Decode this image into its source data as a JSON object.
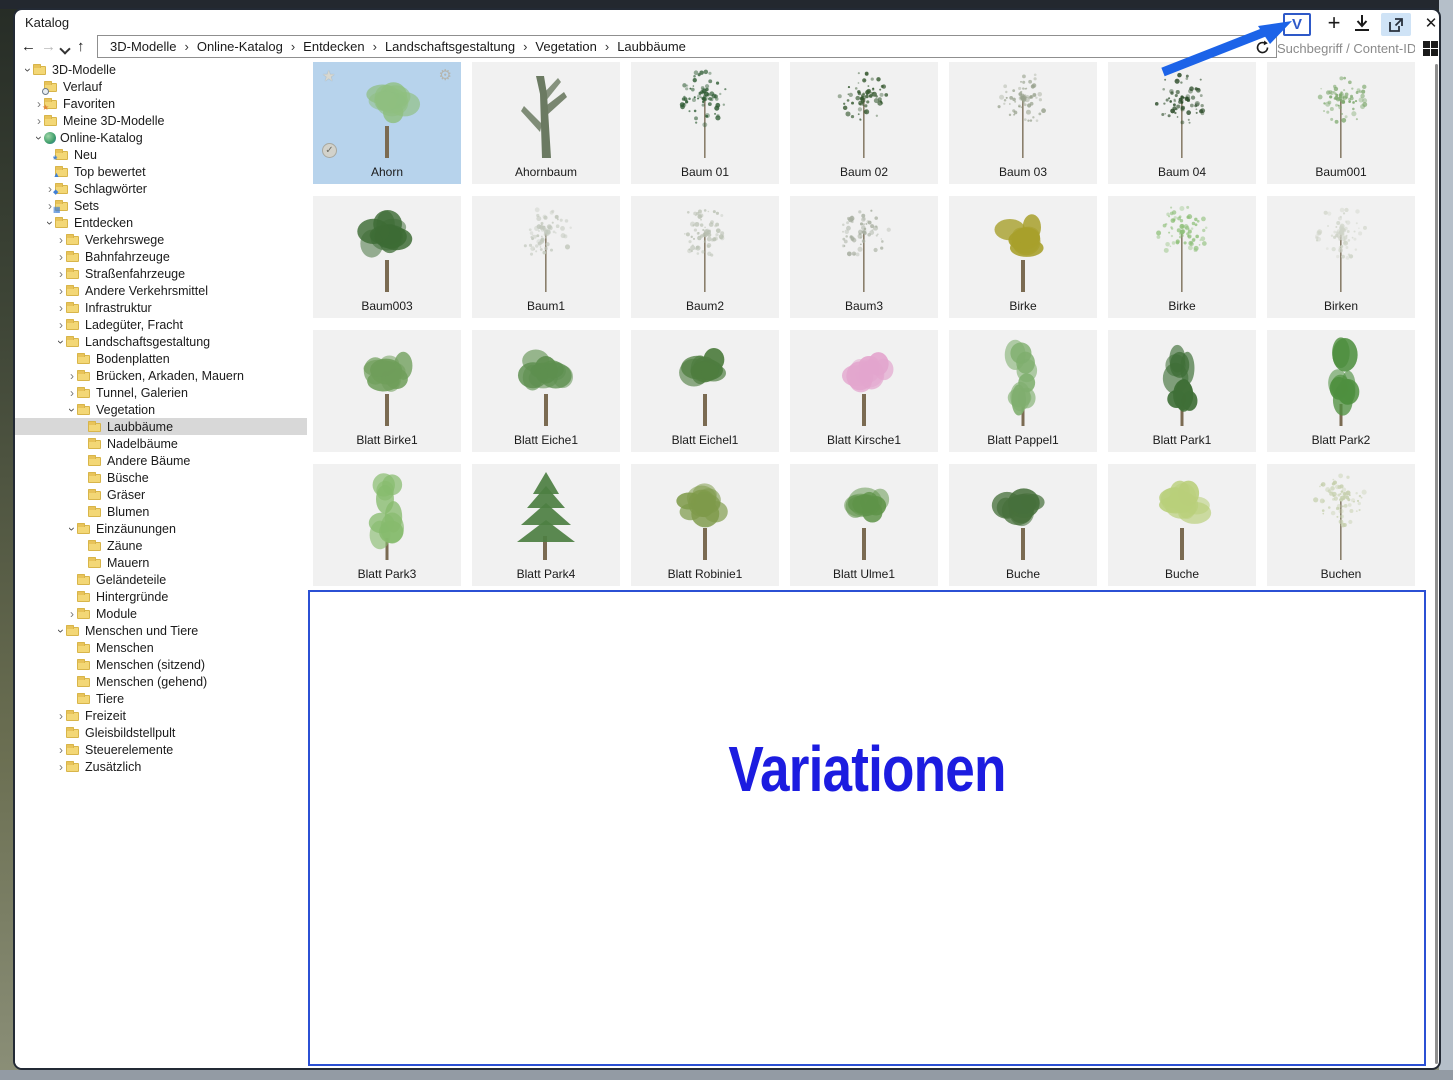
{
  "window": {
    "title": "Katalog"
  },
  "toolbar": {
    "variations_label": "V",
    "plus_label": "+",
    "close_label": "✕",
    "nav": {
      "back": "←",
      "forward": "→",
      "up": "↑"
    }
  },
  "breadcrumb": {
    "separator": "›",
    "items": [
      "3D-Modelle",
      "Online-Katalog",
      "Entdecken",
      "Landschaftsgestaltung",
      "Vegetation",
      "Laubbäume"
    ]
  },
  "search": {
    "placeholder": "Suchbegriff / Content-ID"
  },
  "tree": {
    "items": [
      {
        "label": "3D-Modelle",
        "level": 0,
        "chevron": "expanded",
        "icon": "folder"
      },
      {
        "label": "Verlauf",
        "level": 1,
        "chevron": "none",
        "icon": "history"
      },
      {
        "label": "Favoriten",
        "level": 1,
        "chevron": "collapsed",
        "icon": "favorites"
      },
      {
        "label": "Meine 3D-Modelle",
        "level": 1,
        "chevron": "collapsed",
        "icon": "folder"
      },
      {
        "label": "Online-Katalog",
        "level": 1,
        "chevron": "expanded",
        "icon": "globe"
      },
      {
        "label": "Neu",
        "level": 2,
        "chevron": "none",
        "icon": "new"
      },
      {
        "label": "Top bewertet",
        "level": 2,
        "chevron": "none",
        "icon": "top"
      },
      {
        "label": "Schlagwörter",
        "level": 2,
        "chevron": "collapsed",
        "icon": "tags"
      },
      {
        "label": "Sets",
        "level": 2,
        "chevron": "collapsed",
        "icon": "sets"
      },
      {
        "label": "Entdecken",
        "level": 2,
        "chevron": "expanded",
        "icon": "folder"
      },
      {
        "label": "Verkehrswege",
        "level": 3,
        "chevron": "collapsed",
        "icon": "folder"
      },
      {
        "label": "Bahnfahrzeuge",
        "level": 3,
        "chevron": "collapsed",
        "icon": "folder"
      },
      {
        "label": "Straßenfahrzeuge",
        "level": 3,
        "chevron": "collapsed",
        "icon": "folder"
      },
      {
        "label": "Andere Verkehrsmittel",
        "level": 3,
        "chevron": "collapsed",
        "icon": "folder"
      },
      {
        "label": "Infrastruktur",
        "level": 3,
        "chevron": "collapsed",
        "icon": "folder"
      },
      {
        "label": "Ladegüter, Fracht",
        "level": 3,
        "chevron": "collapsed",
        "icon": "folder"
      },
      {
        "label": "Landschaftsgestaltung",
        "level": 3,
        "chevron": "expanded",
        "icon": "folder"
      },
      {
        "label": "Bodenplatten",
        "level": 4,
        "chevron": "none",
        "icon": "folder"
      },
      {
        "label": "Brücken, Arkaden, Mauern",
        "level": 4,
        "chevron": "collapsed",
        "icon": "folder"
      },
      {
        "label": "Tunnel, Galerien",
        "level": 4,
        "chevron": "collapsed",
        "icon": "folder"
      },
      {
        "label": "Vegetation",
        "level": 4,
        "chevron": "expanded",
        "icon": "folder"
      },
      {
        "label": "Laubbäume",
        "level": 5,
        "chevron": "none",
        "icon": "folder",
        "selected": true
      },
      {
        "label": "Nadelbäume",
        "level": 5,
        "chevron": "none",
        "icon": "folder"
      },
      {
        "label": "Andere Bäume",
        "level": 5,
        "chevron": "none",
        "icon": "folder"
      },
      {
        "label": "Büsche",
        "level": 5,
        "chevron": "none",
        "icon": "folder"
      },
      {
        "label": "Gräser",
        "level": 5,
        "chevron": "none",
        "icon": "folder"
      },
      {
        "label": "Blumen",
        "level": 5,
        "chevron": "none",
        "icon": "folder"
      },
      {
        "label": "Einzäunungen",
        "level": 4,
        "chevron": "expanded",
        "icon": "folder"
      },
      {
        "label": "Zäune",
        "level": 5,
        "chevron": "none",
        "icon": "folder"
      },
      {
        "label": "Mauern",
        "level": 5,
        "chevron": "none",
        "icon": "folder"
      },
      {
        "label": "Geländeteile",
        "level": 4,
        "chevron": "none",
        "icon": "folder"
      },
      {
        "label": "Hintergründe",
        "level": 4,
        "chevron": "none",
        "icon": "folder"
      },
      {
        "label": "Module",
        "level": 4,
        "chevron": "collapsed",
        "icon": "folder"
      },
      {
        "label": "Menschen und Tiere",
        "level": 3,
        "chevron": "expanded",
        "icon": "folder"
      },
      {
        "label": "Menschen",
        "level": 4,
        "chevron": "none",
        "icon": "folder"
      },
      {
        "label": "Menschen (sitzend)",
        "level": 4,
        "chevron": "none",
        "icon": "folder"
      },
      {
        "label": "Menschen (gehend)",
        "level": 4,
        "chevron": "none",
        "icon": "folder"
      },
      {
        "label": "Tiere",
        "level": 4,
        "chevron": "none",
        "icon": "folder"
      },
      {
        "label": "Freizeit",
        "level": 3,
        "chevron": "collapsed",
        "icon": "folder"
      },
      {
        "label": "Gleisbildstellpult",
        "level": 3,
        "chevron": "none",
        "icon": "folder"
      },
      {
        "label": "Steuerelemente",
        "level": 3,
        "chevron": "collapsed",
        "icon": "folder"
      },
      {
        "label": "Zusätzlich",
        "level": 3,
        "chevron": "collapsed",
        "icon": "folder"
      }
    ]
  },
  "grid": {
    "items": [
      {
        "label": "Ahorn",
        "type": "round",
        "color": "#8fbf7f",
        "selected": true
      },
      {
        "label": "Ahornbaum",
        "type": "trunk",
        "color": "#6b7a62"
      },
      {
        "label": "Baum 01",
        "type": "sparse",
        "color": "#2e5b33"
      },
      {
        "label": "Baum 02",
        "type": "sparse",
        "color": "#35582f"
      },
      {
        "label": "Baum 03",
        "type": "sparse",
        "color": "#9aa38f"
      },
      {
        "label": "Baum 04",
        "type": "sparse",
        "color": "#2f4e2c"
      },
      {
        "label": "Baum001",
        "type": "sparse",
        "color": "#7fa96f"
      },
      {
        "label": "Baum003",
        "type": "round",
        "color": "#3d6b35"
      },
      {
        "label": "Baum1",
        "type": "sparse",
        "color": "#c2c8bd"
      },
      {
        "label": "Baum2",
        "type": "sparse",
        "color": "#b9c0b2"
      },
      {
        "label": "Baum3",
        "type": "sparse",
        "color": "#a9b0a2"
      },
      {
        "label": "Birke",
        "type": "round",
        "color": "#a8a02c"
      },
      {
        "label": "Birke",
        "type": "sparse",
        "color": "#8fc07a"
      },
      {
        "label": "Birken",
        "type": "sparse",
        "color": "#cfd4c8"
      },
      {
        "label": "Blatt Birke1",
        "type": "round",
        "color": "#6f9e5a"
      },
      {
        "label": "Blatt Eiche1",
        "type": "round",
        "color": "#5d8f4e"
      },
      {
        "label": "Blatt Eichel1",
        "type": "round",
        "color": "#4e7d3f"
      },
      {
        "label": "Blatt Kirsche1",
        "type": "round",
        "color": "#e3a6ce"
      },
      {
        "label": "Blatt Pappel1",
        "type": "tall",
        "color": "#7fae6e"
      },
      {
        "label": "Blatt Park1",
        "type": "tall",
        "color": "#3f6f37"
      },
      {
        "label": "Blatt Park2",
        "type": "tall",
        "color": "#4e8f3f"
      },
      {
        "label": "Blatt Park3",
        "type": "tall",
        "color": "#86bb6d"
      },
      {
        "label": "Blatt Park4",
        "type": "conifer",
        "color": "#4d7f42"
      },
      {
        "label": "Blatt Robinie1",
        "type": "round",
        "color": "#7e9a4a"
      },
      {
        "label": "Blatt Ulme1",
        "type": "round",
        "color": "#5f9348"
      },
      {
        "label": "Buche",
        "type": "round",
        "color": "#47703c"
      },
      {
        "label": "Buche",
        "type": "round",
        "color": "#b9cf7a"
      },
      {
        "label": "Buchen",
        "type": "sparse",
        "color": "#c5cfad"
      }
    ],
    "selected_icons": {
      "star": "★",
      "gear": "⚙",
      "check": "✓"
    }
  },
  "overlay": {
    "title": "Variationen"
  },
  "colors": {
    "selected_tile": "#b7d3ec",
    "tile_bg": "#f1f1f1",
    "accent_blue": "#2e59c8",
    "overlay_border": "#2b50d4",
    "overlay_text": "#1c1ce0",
    "arrow": "#1c63e8",
    "tree_selection": "#d8d8d8"
  }
}
